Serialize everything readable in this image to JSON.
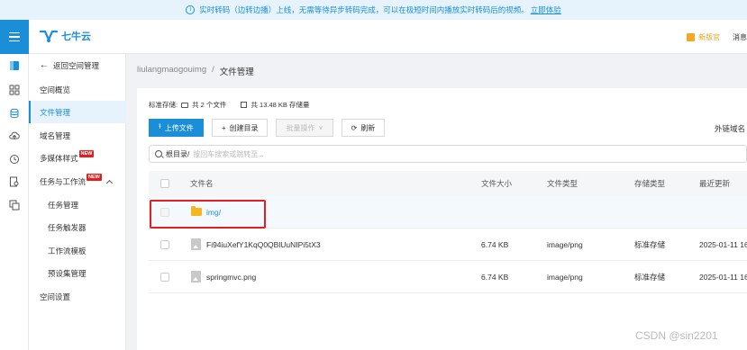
{
  "notice": {
    "text": "实时转码（边转边播）上线，无需等待异步转码完成，可以在极短时间内播放实时转码后的视频。",
    "link": "立即体验"
  },
  "topbar": {
    "brand": "七牛云",
    "new_link": "新版官",
    "messages": "消息"
  },
  "sidebar": {
    "back": "返回空间管理",
    "items": [
      {
        "label": "空间概览"
      },
      {
        "label": "文件管理"
      },
      {
        "label": "域名管理"
      },
      {
        "label": "多媒体样式",
        "badge": "NEW"
      },
      {
        "label": "任务与工作流",
        "badge": "NEW"
      },
      {
        "label": "任务管理"
      },
      {
        "label": "任务触发器"
      },
      {
        "label": "工作流模板"
      },
      {
        "label": "预设集管理"
      },
      {
        "label": "空间设置"
      }
    ]
  },
  "breadcrumb": {
    "bucket": "liulangmaogouimg",
    "separator": "/",
    "current": "文件管理"
  },
  "stats": {
    "storage_type": "标准存储:",
    "file_count": "共 2 个文件",
    "size": "共 13.48 KB 存储量"
  },
  "toolbar": {
    "upload": "上传文件",
    "create_dir": "创建目录",
    "batch": "批量操作",
    "refresh": "刷新",
    "domain": "外链域名"
  },
  "search": {
    "prefix": "根目录/",
    "placeholder": "按回车搜索或跳转至..."
  },
  "table": {
    "headers": {
      "name": "文件名",
      "size": "文件大小",
      "type": "文件类型",
      "storage": "存储类型",
      "updated": "最近更新"
    },
    "rows": [
      {
        "name": "img/",
        "size": "",
        "type": "",
        "storage": "",
        "updated": ""
      },
      {
        "name": "Fi94iuXefY1KqQ0QBlUuNIPi5tX3",
        "size": "6.74 KB",
        "type": "image/png",
        "storage": "标准存储",
        "updated": "2025-01-11 16"
      },
      {
        "name": "springmvc.png",
        "size": "6.74 KB",
        "type": "image/png",
        "storage": "标准存储",
        "updated": "2025-01-11 16"
      }
    ]
  },
  "watermark": "CSDN @sin2201",
  "colors": {
    "accent": "#1a8fd8",
    "highlight": "#e02020",
    "folder": "#f5b624"
  }
}
